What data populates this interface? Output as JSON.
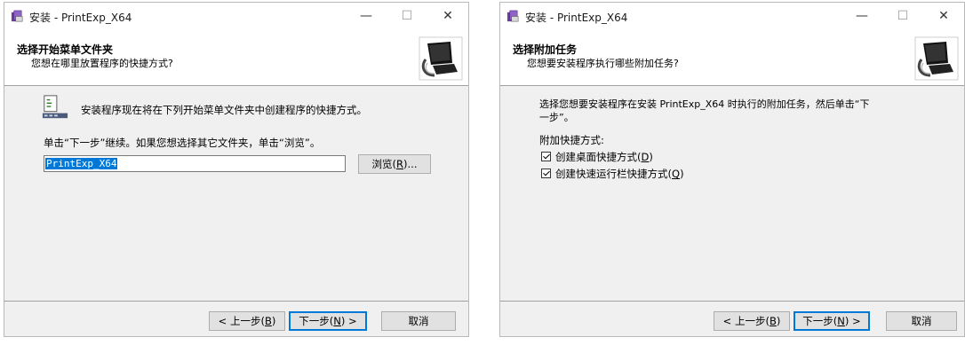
{
  "window1": {
    "title": "安装 - PrintExp_X64",
    "header_title": "选择开始菜单文件夹",
    "header_subtitle": "您想在哪里放置程序的快捷方式?",
    "intro": "安装程序现在将在下列开始菜单文件夹中创建程序的快捷方式。",
    "instruction": "单击“下一步”继续。如果您想选择其它文件夹，单击“浏览”。",
    "folder_value": "PrintExp_X64",
    "browse_prefix": "浏览(",
    "browse_key": "R",
    "browse_suffix": ")...",
    "back_prefix": "< 上一步(",
    "back_key": "B",
    "back_suffix": ")",
    "next_prefix": "下一步(",
    "next_key": "N",
    "next_suffix": ") >",
    "cancel": "取消"
  },
  "window2": {
    "title": "安装 - PrintExp_X64",
    "header_title": "选择附加任务",
    "header_subtitle": "您想要安装程序执行哪些附加任务?",
    "intro_line1": "选择您想要安装程序在安装 PrintExp_X64 时执行的附加任务，然后单击“下",
    "intro_line2": "一步”。",
    "group_label": "附加快捷方式:",
    "task1_prefix": "创建桌面快捷方式(",
    "task1_key": "D",
    "task1_suffix": ")",
    "task2_prefix": "创建快速运行栏快捷方式(",
    "task2_key": "Q",
    "task2_suffix": ")",
    "back_prefix": "< 上一步(",
    "back_key": "B",
    "back_suffix": ")",
    "next_prefix": "下一步(",
    "next_key": "N",
    "next_suffix": ") >",
    "cancel": "取消"
  },
  "controls": {
    "minimize": "—",
    "maximize": "☐",
    "close": "✕"
  },
  "icons": {
    "app": "installer-app-icon",
    "logo": "computer-install-logo",
    "folder": "start-menu-folder-icon"
  },
  "colors": {
    "accent": "#0078d7",
    "face": "#f0f0f0"
  }
}
